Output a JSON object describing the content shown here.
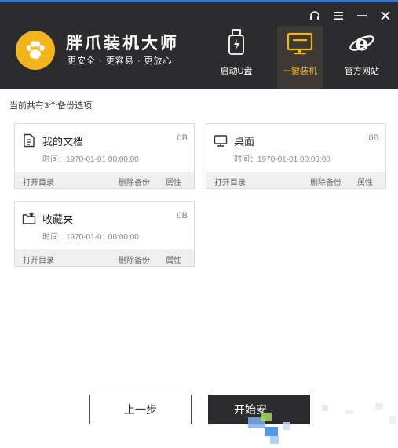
{
  "app": {
    "title": "胖爪装机大师",
    "slogan": "更安全 · 更容易 · 更放心"
  },
  "window_controls": [
    "headset-icon",
    "menu-icon",
    "minimize-icon",
    "close-icon"
  ],
  "nav": [
    {
      "label": "启动U盘",
      "icon": "usb-drive-icon",
      "active": false
    },
    {
      "label": "一键装机",
      "icon": "monitor-icon",
      "active": true
    },
    {
      "label": "官方网站",
      "icon": "ie-browser-icon",
      "active": false
    }
  ],
  "summary": "当前共有3个备份选项:",
  "cards": [
    {
      "name": "我的文档",
      "size": "0B",
      "time": "时间：1970-01-01 00:00:00",
      "open": "打开目录",
      "delete": "删除备份",
      "props": "属性",
      "icon": "document-icon"
    },
    {
      "name": "桌面",
      "size": "0B",
      "time": "时间：1970-01-01 00:00:00",
      "open": "打开目录",
      "delete": "删除备份",
      "props": "属性",
      "icon": "desktop-icon"
    },
    {
      "name": "收藏夹",
      "size": "0B",
      "time": "时间：1970-01-01 00:00:00",
      "open": "打开目录",
      "delete": "删除备份",
      "props": "属性",
      "icon": "favorites-folder-icon"
    }
  ],
  "buttons": {
    "prev": "上一步",
    "start": "开始安"
  },
  "colors": {
    "header_bg": "#2c2c2e",
    "accent": "#f3b51c",
    "card_bar": "#efefef"
  }
}
